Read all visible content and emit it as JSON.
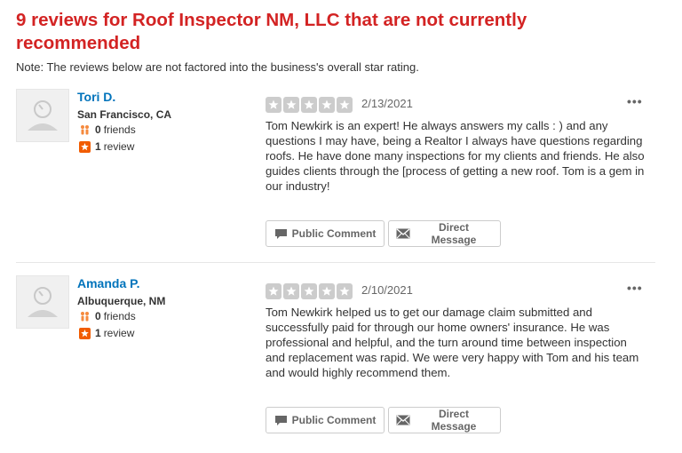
{
  "header": {
    "title": "9 reviews for Roof Inspector NM, LLC that are not currently recommended",
    "note": "Note: The reviews below are not factored into the business's overall star rating."
  },
  "reviews": [
    {
      "user": {
        "name": "Tori D.",
        "location": "San Francisco, CA",
        "friends_count": "0",
        "friends_label": "friends",
        "reviews_count": "1",
        "reviews_label": "review"
      },
      "rating": 5,
      "date": "2/13/2021",
      "text": "Tom Newkirk is an expert! He always answers my calls : ) and any questions I may have, being a Realtor I always have questions regarding roofs. He have done many inspections for my clients and friends. He also guides clients through the [process of getting a new roof. Tom is a gem in our industry!",
      "more_label": "•••",
      "actions": {
        "comment": "Public Comment",
        "message": "Direct Message"
      }
    },
    {
      "user": {
        "name": "Amanda P.",
        "location": "Albuquerque, NM",
        "friends_count": "0",
        "friends_label": "friends",
        "reviews_count": "1",
        "reviews_label": "review"
      },
      "rating": 5,
      "date": "2/10/2021",
      "text": "Tom Newkirk helped us to get our damage claim submitted and successfully paid for through our home owners' insurance. He was professional and helpful, and the turn around time between inspection and replacement was rapid. We were very happy with Tom and his team and would highly recommend them.",
      "more_label": "•••",
      "actions": {
        "comment": "Public Comment",
        "message": "Direct Message"
      }
    }
  ],
  "colors": {
    "heading": "#d32323",
    "link": "#0073bb",
    "star_empty": "#cccccc",
    "friends_icon": "#f58a3e",
    "review_icon": "#f15c00"
  },
  "icons": {
    "avatar": "user-silhouette-icon",
    "friends": "friends-icon",
    "reviews": "review-star-icon",
    "comment": "speech-bubble-icon",
    "message": "envelope-icon",
    "more": "more-options-icon"
  }
}
